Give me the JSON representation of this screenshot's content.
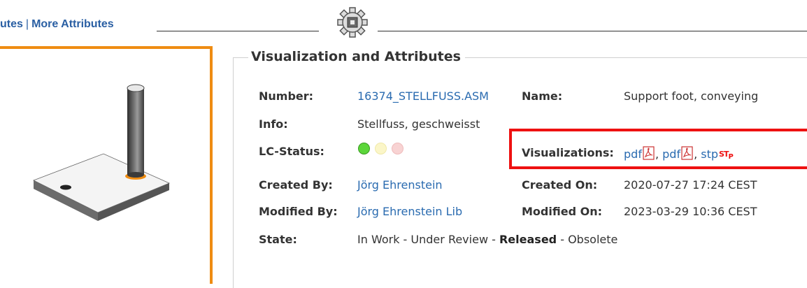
{
  "top_links": {
    "attributes": "utes",
    "separator": "|",
    "more": "More Attributes"
  },
  "section": {
    "title": "Visualization and Attributes"
  },
  "fields": {
    "number_label": "Number:",
    "number_value": "16374_STELLFUSS.ASM",
    "name_label": "Name:",
    "name_value": "Support foot, conveying",
    "info_label": "Info:",
    "info_value": "Stellfuss, geschweisst",
    "lc_status_label": "LC-Status:",
    "lc_status_lights": [
      "green",
      "yellow-dim",
      "red-dim"
    ],
    "visualizations_label": "Visualizations:",
    "visualizations": [
      {
        "label": "pdf",
        "icon": "pdf-icon"
      },
      {
        "label": "pdf",
        "icon": "pdf-icon"
      },
      {
        "label": "stp",
        "icon": "stp-icon",
        "badge": "ST",
        "badge_sub": "P"
      }
    ],
    "created_by_label": "Created By:",
    "created_by_value": "Jörg Ehrenstein",
    "created_on_label": "Created On:",
    "created_on_value": "2020-07-27 17:24 CEST",
    "modified_by_label": "Modified By:",
    "modified_by_value": "Jörg Ehrenstein Lib",
    "modified_on_label": "Modified On:",
    "modified_on_value": "2023-03-29 10:36 CEST",
    "state_label": "State:",
    "states": [
      "In Work",
      "Under Review",
      "Released",
      "Obsolete"
    ],
    "state_separator": " - ",
    "state_current": "Released"
  },
  "colors": {
    "link": "#2a6bb0",
    "accent_orange": "#ef8c12",
    "highlight_red": "#ee1111",
    "status_green": "#5cd63a",
    "status_yellow_dim": "#fbf6c8",
    "status_red_dim": "#f8d3d3"
  }
}
